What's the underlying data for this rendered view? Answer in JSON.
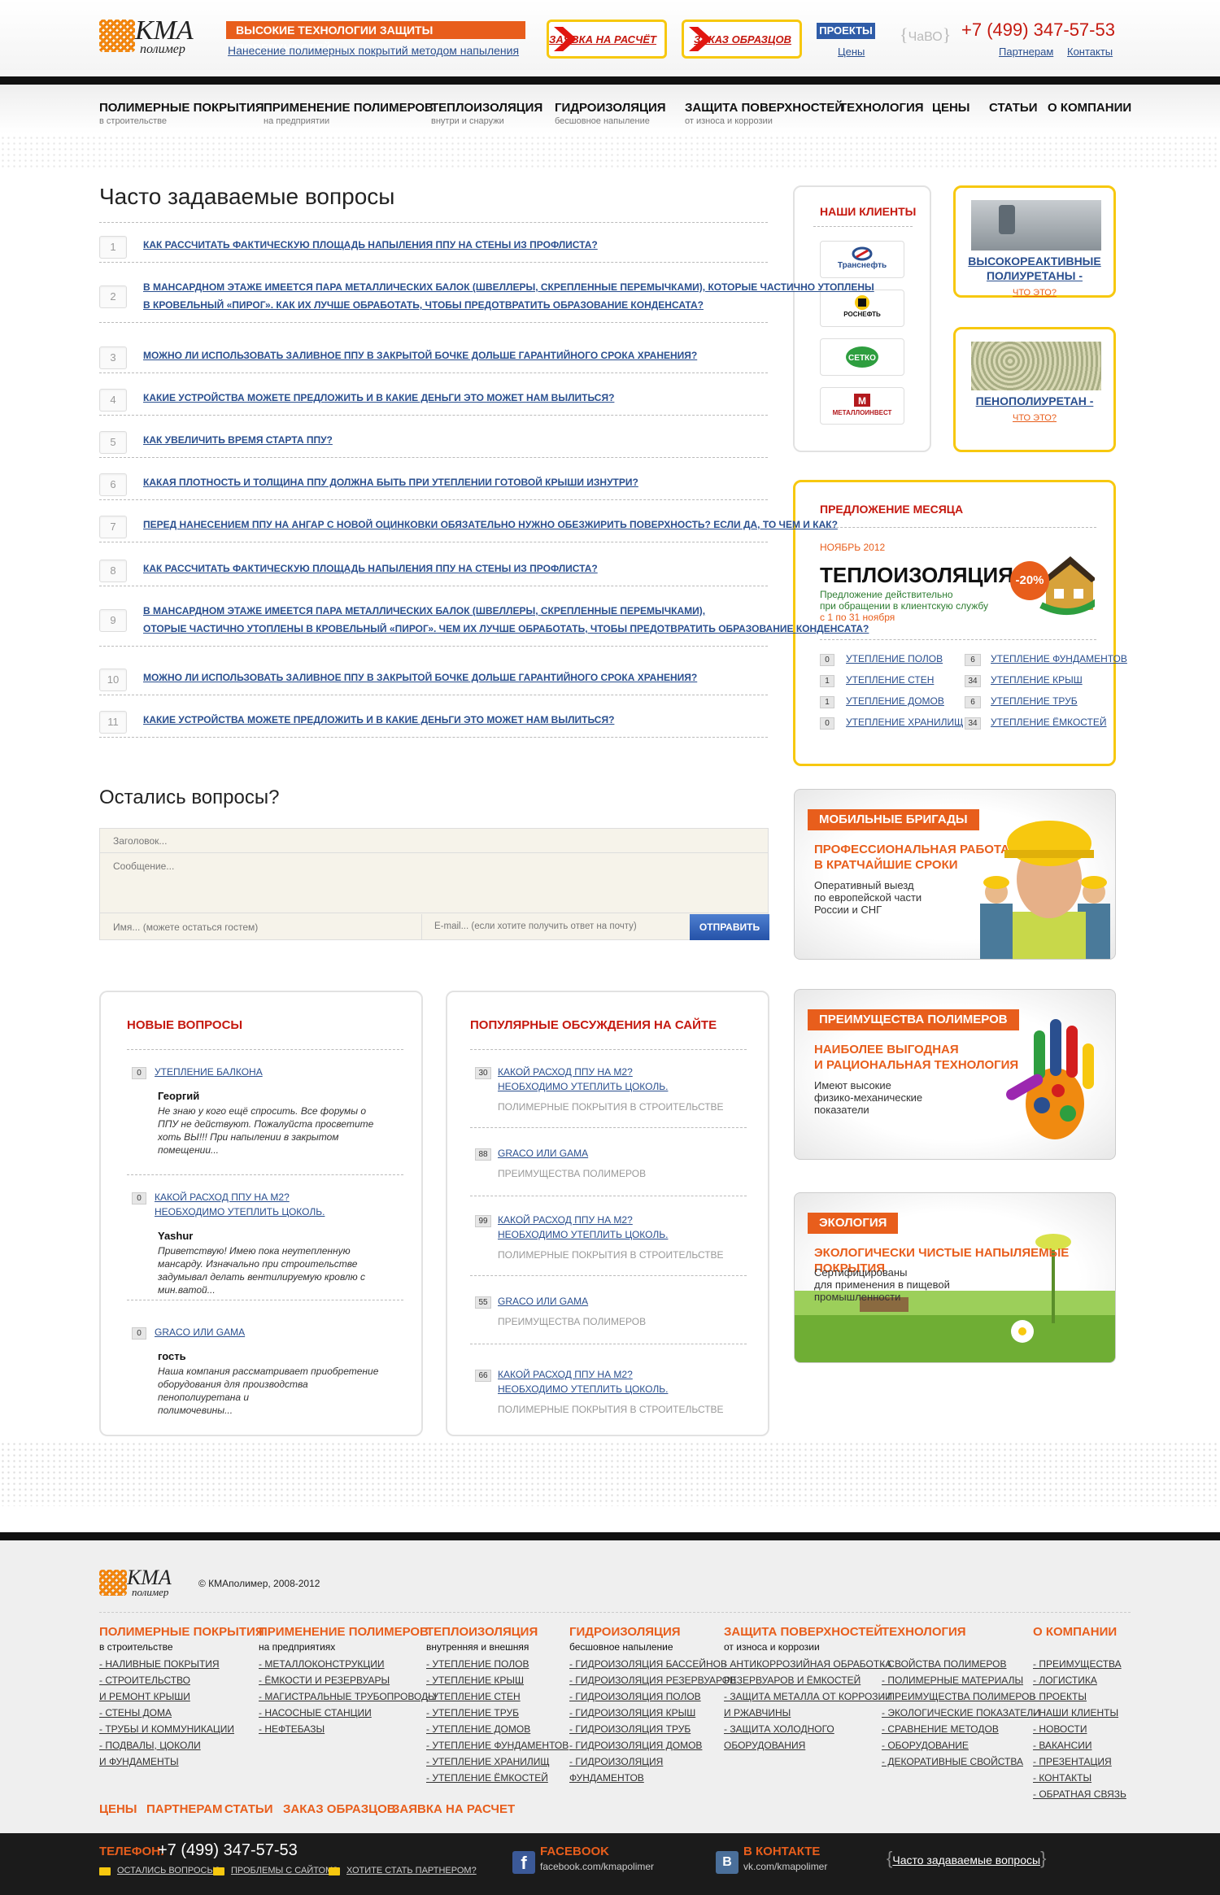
{
  "header": {
    "logo_title": "КМА",
    "logo_sub": "полимер",
    "slogan": "ВЫСОКИЕ ТЕХНОЛОГИИ ЗАЩИТЫ ПОВЕРХНОСТЕЙ",
    "slogan_link": "Нанесение полимерных покрытий методом напыления",
    "btn_request": "ЗАЯВКА НА РАСЧЁТ",
    "btn_samples": "ЗАКАЗ ОБРАЗЦОВ",
    "projects": "ПРОЕКТЫ",
    "prices": "Цены",
    "faq": "ЧаВО",
    "phone": "+7 (499) 347-57-53",
    "partners": "Партнерам",
    "contacts": "Контакты"
  },
  "nav": [
    {
      "title": "ПОЛИМЕРНЫЕ ПОКРЫТИЯ",
      "sub": "в строительстве"
    },
    {
      "title": "ПРИМЕНЕНИЕ ПОЛИМЕРОВ",
      "sub": "на предприятии"
    },
    {
      "title": "ТЕПЛОИЗОЛЯЦИЯ",
      "sub": "внутри и снаружи"
    },
    {
      "title": "ГИДРОИЗОЛЯЦИЯ",
      "sub": "бесшовное напыление"
    },
    {
      "title": "ЗАЩИТА ПОВЕРХНОСТЕЙ",
      "sub": "от износа и коррозии"
    },
    {
      "title": "ТЕХНОЛОГИЯ",
      "sub": ""
    },
    {
      "title": "ЦЕНЫ",
      "sub": ""
    },
    {
      "title": "СТАТЬИ",
      "sub": ""
    },
    {
      "title": "О КОМПАНИИ",
      "sub": ""
    }
  ],
  "faq": {
    "title": "Часто задаваемые вопросы",
    "items": [
      {
        "n": "1",
        "l1": "КАК РАССЧИТАТЬ ФАКТИЧЕСКУЮ ПЛОЩАДЬ НАПЫЛЕНИЯ ППУ НА СТЕНЫ ИЗ ПРОФЛИСТА?",
        "l2": ""
      },
      {
        "n": "2",
        "l1": "В МАНСАРДНОМ ЭТАЖЕ ИМЕЕТСЯ ПАРА МЕТАЛЛИЧЕСКИХ БАЛОК (ШВЕЛЛЕРЫ, СКРЕПЛЕННЫЕ ПЕРЕМЫЧКАМИ), КОТОРЫЕ ЧАСТИЧНО УТОПЛЕНЫ",
        "l2": "В КРОВЕЛЬНЫЙ «ПИРОГ». КАК ИХ ЛУЧШЕ ОБРАБОТАТЬ, ЧТОБЫ ПРЕДОТВРАТИТЬ ОБРАЗОВАНИЕ КОНДЕНСАТА?"
      },
      {
        "n": "3",
        "l1": "МОЖНО ЛИ ИСПОЛЬЗОВАТЬ ЗАЛИВНОЕ ППУ В ЗАКРЫТОЙ БОЧКЕ ДОЛЬШЕ ГАРАНТИЙНОГО СРОКА ХРАНЕНИЯ?",
        "l2": ""
      },
      {
        "n": "4",
        "l1": "КАКИЕ УСТРОЙСТВА МОЖЕТЕ ПРЕДЛОЖИТЬ И В КАКИЕ ДЕНЬГИ ЭТО МОЖЕТ НАМ ВЫЛИТЬСЯ?",
        "l2": ""
      },
      {
        "n": "5",
        "l1": "КАК УВЕЛИЧИТЬ ВРЕМЯ СТАРТА ППУ?",
        "l2": ""
      },
      {
        "n": "6",
        "l1": "КАКАЯ ПЛОТНОСТЬ И ТОЛЩИНА ППУ ДОЛЖНА БЫТЬ ПРИ УТЕПЛЕНИИ ГОТОВОЙ КРЫШИ ИЗНУТРИ?",
        "l2": ""
      },
      {
        "n": "7",
        "l1": "ПЕРЕД НАНЕСЕНИЕМ ППУ НА АНГАР С НОВОЙ ОЦИНКОВКИ ОБЯЗАТЕЛЬНО НУЖНО ОБЕЗЖИРИТЬ ПОВЕРХНОСТЬ? ЕСЛИ ДА, ТО ЧЕМ И КАК?",
        "l2": ""
      },
      {
        "n": "8",
        "l1": "КАК РАССЧИТАТЬ ФАКТИЧЕСКУЮ ПЛОЩАДЬ НАПЫЛЕНИЯ ППУ НА СТЕНЫ ИЗ ПРОФЛИСТА?",
        "l2": ""
      },
      {
        "n": "9",
        "l1": "В МАНСАРДНОМ ЭТАЖЕ ИМЕЕТСЯ ПАРА МЕТАЛЛИЧЕСКИХ БАЛОК (ШВЕЛЛЕРЫ, СКРЕПЛЕННЫЕ ПЕРЕМЫЧКАМИ),",
        "l2": "ОТОРЫЕ ЧАСТИЧНО УТОПЛЕНЫ В КРОВЕЛЬНЫЙ «ПИРОГ». ЧЕМ ИХ ЛУЧШЕ ОБРАБОТАТЬ, ЧТОБЫ ПРЕДОТВРАТИТЬ ОБРАЗОВАНИЕ КОНДЕНСАТА?"
      },
      {
        "n": "10",
        "l1": "МОЖНО ЛИ ИСПОЛЬЗОВАТЬ ЗАЛИВНОЕ ППУ В ЗАКРЫТОЙ БОЧКЕ ДОЛЬШЕ ГАРАНТИЙНОГО СРОКА ХРАНЕНИЯ?",
        "l2": ""
      },
      {
        "n": "11",
        "l1": "КАКИЕ УСТРОЙСТВА МОЖЕТЕ ПРЕДЛОЖИТЬ И В КАКИЕ ДЕНЬГИ ЭТО МОЖЕТ НАМ ВЫЛИТЬСЯ?",
        "l2": ""
      }
    ]
  },
  "ask": {
    "title": "Остались вопросы?",
    "subject_ph": "Заголовок...",
    "message_ph": "Сообщение...",
    "name_ph": "Имя... (можете остаться гостем)",
    "email_ph": "E-mail... (если хотите получить ответ на почту)",
    "send": "ОТПРАВИТЬ"
  },
  "new_questions": {
    "title": "НОВЫЕ ВОПРОСЫ",
    "items": [
      {
        "count": "0",
        "t1": "УТЕПЛЕНИЕ БАЛКОНА",
        "t2": "",
        "author": "Георгий",
        "text": [
          "Не знаю у кого ещё спросить. Все форумы о",
          "ППУ не действуют. Пожалуйста просветите",
          "хоть ВЫ!!! При напылении в закрытом",
          "помещении..."
        ]
      },
      {
        "count": "0",
        "t1": "КАКОЙ РАСХОД ППУ НА М2?",
        "t2": "НЕОБХОДИМО УТЕПЛИТЬ ЦОКОЛЬ.",
        "author": "Yashur",
        "text": [
          "Приветствую! Имею пока неутепленную",
          "мансарду. Изначально при строительстве",
          "задумывал делать вентилируемую кровлю с",
          "мин.ватой..."
        ]
      },
      {
        "count": "0",
        "t1": "GRACO ИЛИ GAMA",
        "t2": "",
        "author": "гость",
        "text": [
          "Наша компания рассматривает приобретение",
          "оборудования для производства",
          "пенополиуретана и",
          "полимочевины..."
        ]
      }
    ]
  },
  "popular": {
    "title": "ПОПУЛЯРНЫЕ ОБСУЖДЕНИЯ НА САЙТЕ",
    "items": [
      {
        "count": "30",
        "t1": "КАКОЙ РАСХОД ППУ НА М2?",
        "t2": "НЕОБХОДИМО УТЕПЛИТЬ ЦОКОЛЬ.",
        "cat": "ПОЛИМЕРНЫЕ ПОКРЫТИЯ В СТРОИТЕЛЬСТВЕ"
      },
      {
        "count": "88",
        "t1": "GRACO ИЛИ GAMA",
        "t2": "",
        "cat": "ПРЕИМУЩЕСТВА ПОЛИМЕРОВ"
      },
      {
        "count": "99",
        "t1": "КАКОЙ РАСХОД ППУ НА М2?",
        "t2": "НЕОБХОДИМО УТЕПЛИТЬ ЦОКОЛЬ.",
        "cat": "ПОЛИМЕРНЫЕ ПОКРЫТИЯ В СТРОИТЕЛЬСТВЕ"
      },
      {
        "count": "55",
        "t1": "GRACO ИЛИ GAMA",
        "t2": "",
        "cat": "ПРЕИМУЩЕСТВА ПОЛИМЕРОВ"
      },
      {
        "count": "66",
        "t1": "КАКОЙ РАСХОД ППУ НА М2?",
        "t2": "НЕОБХОДИМО УТЕПЛИТЬ ЦОКОЛЬ.",
        "cat": "ПОЛИМЕРНЫЕ ПОКРЫТИЯ В СТРОИТЕЛЬСТВЕ"
      }
    ]
  },
  "clients": {
    "title": "НАШИ КЛИЕНТЫ",
    "logos": [
      "Транснефть",
      "РОСНЕФТЬ",
      "СЕТКО",
      "МЕТАЛЛОИНВЕСТ"
    ]
  },
  "products": [
    {
      "title": "ВЫСОКОРЕАКТИВНЫЕ ПОЛИУРЕТАНЫ -",
      "link": "ЧТО ЭТО?"
    },
    {
      "title": "ПЕНОПОЛИУРЕТАН -",
      "link": "ЧТО ЭТО?"
    }
  ],
  "offer": {
    "title": "ПРЕДЛОЖЕНИЕ МЕСЯЦА",
    "date": "НОЯБРЬ 2012",
    "name": "ТЕПЛОИЗОЛЯЦИЯ",
    "discount": "-20%",
    "desc1": "Предложение действительно",
    "desc2": "при обращении в клиентскую службу",
    "desc3": "с 1 по 31 ноября",
    "links_left": [
      {
        "count": "0",
        "label": "УТЕПЛЕНИЕ ПОЛОВ"
      },
      {
        "count": "1",
        "label": "УТЕПЛЕНИЕ СТЕН"
      },
      {
        "count": "1",
        "label": "УТЕПЛЕНИЕ ДОМОВ"
      },
      {
        "count": "0",
        "label": "УТЕПЛЕНИЕ ХРАНИЛИЩ"
      }
    ],
    "links_right": [
      {
        "count": "6",
        "label": "УТЕПЛЕНИЕ ФУНДАМЕНТОВ"
      },
      {
        "count": "34",
        "label": "УТЕПЛЕНИЕ КРЫШ"
      },
      {
        "count": "6",
        "label": "УТЕПЛЕНИЕ ТРУБ"
      },
      {
        "count": "34",
        "label": "УТЕПЛЕНИЕ ЁМКОСТЕЙ"
      }
    ]
  },
  "promos": [
    {
      "tag": "МОБИЛЬНЫЕ БРИГАДЫ",
      "o1": "ПРОФЕССИОНАЛЬНАЯ РАБОТА",
      "o2": "В КРАТЧАЙШИЕ СРОКИ",
      "d1": "Оперативный выезд",
      "d2": "по европейской части",
      "d3": "России и СНГ"
    },
    {
      "tag": "ПРЕИМУЩЕСТВА ПОЛИМЕРОВ",
      "o1": "НАИБОЛЕЕ ВЫГОДНАЯ",
      "o2": "И РАЦИОНАЛЬНАЯ ТЕХНОЛОГИЯ",
      "d1": "Имеют высокие",
      "d2": "физико-механические",
      "d3": "показатели"
    },
    {
      "tag": "ЭКОЛОГИЯ",
      "o1": "ЭКОЛОГИЧЕСКИ ЧИСТЫЕ НАПЫЛЯЕМЫЕ ПОКРЫТИЯ",
      "o2": "",
      "d1": "Сертифицированы",
      "d2": "для применения в пищевой",
      "d3": "промышленности"
    }
  ],
  "footer": {
    "copyright": "© КМАполимер, 2008-2012",
    "cols": [
      {
        "h": "ПОЛИМЕРНЫЕ ПОКРЫТИЯ",
        "s": "в строительстве",
        "links": [
          "- НАЛИВНЫЕ ПОКРЫТИЯ",
          "- СТРОИТЕЛЬСТВО",
          "И РЕМОНТ КРЫШИ",
          "- СТЕНЫ ДОМА",
          "- ТРУБЫ И КОММУНИКАЦИИ",
          "- ПОДВАЛЫ, ЦОКОЛИ",
          "И ФУНДАМЕНТЫ"
        ]
      },
      {
        "h": "ПРИМЕНЕНИЕ ПОЛИМЕРОВ",
        "s": "на предприятиях",
        "links": [
          "- МЕТАЛЛОКОНСТРУКЦИИ",
          "- ЁМКОСТИ И РЕЗЕРВУАРЫ",
          "- МАГИСТРАЛЬНЫЕ ТРУБОПРОВОДЫ",
          "- НАСОСНЫЕ СТАНЦИИ",
          "- НЕФТЕБАЗЫ"
        ]
      },
      {
        "h": "ТЕПЛОИЗОЛЯЦИЯ",
        "s": "внутренняя и внешняя",
        "links": [
          "- УТЕПЛЕНИЕ ПОЛОВ",
          "- УТЕПЛЕНИЕ КРЫШ",
          "- УТЕПЛЕНИЕ СТЕН",
          "- УТЕПЛЕНИЕ ТРУБ",
          "- УТЕПЛЕНИЕ ДОМОВ",
          "- УТЕПЛЕНИЕ ФУНДАМЕНТОВ",
          "- УТЕПЛЕНИЕ ХРАНИЛИЩ",
          "- УТЕПЛЕНИЕ ЁМКОСТЕЙ"
        ]
      },
      {
        "h": "ГИДРОИЗОЛЯЦИЯ",
        "s": "бесшовное напыление",
        "links": [
          "- ГИДРОИЗОЛЯЦИЯ БАССЕЙНОВ",
          "- ГИДРОИЗОЛЯЦИЯ РЕЗЕРВУАРОВ",
          "- ГИДРОИЗОЛЯЦИЯ ПОЛОВ",
          "- ГИДРОИЗОЛЯЦИЯ КРЫШ",
          "- ГИДРОИЗОЛЯЦИЯ ТРУБ",
          "- ГИДРОИЗОЛЯЦИЯ ДОМОВ",
          "- ГИДРОИЗОЛЯЦИЯ",
          "ФУНДАМЕНТОВ"
        ]
      },
      {
        "h": "ЗАЩИТА ПОВЕРХНОСТЕЙ",
        "s": "от износа и коррозии",
        "links": [
          "- АНТИКОРРОЗИЙНАЯ ОБРАБОТКА",
          "РЕЗЕРВУАРОВ И ЁМКОСТЕЙ",
          "- ЗАЩИТА МЕТАЛЛА ОТ КОРРОЗИИ",
          "И РЖАВЧИНЫ",
          "- ЗАЩИТА ХОЛОДНОГО",
          "ОБОРУДОВАНИЯ"
        ]
      },
      {
        "h": "ТЕХНОЛОГИЯ",
        "s": "",
        "links": [
          "- СВОЙСТВА ПОЛИМЕРОВ",
          "- ПОЛИМЕРНЫЕ МАТЕРИАЛЫ",
          "- ПРЕИМУЩЕСТВА ПОЛИМЕРОВ",
          "- ЭКОЛОГИЧЕСКИЕ ПОКАЗАТЕЛИ",
          "- СРАВНЕНИЕ МЕТОДОВ",
          "- ОБОРУДОВАНИЕ",
          "- ДЕКОРАТИВНЫЕ СВОЙСТВА"
        ]
      },
      {
        "h": "О КОМПАНИИ",
        "s": "",
        "links": [
          "- ПРЕИМУЩЕСТВА",
          "- ЛОГИСТИКА",
          "- ПРОЕКТЫ",
          "- НАШИ КЛИЕНТЫ",
          "- НОВОСТИ",
          "- ВАКАНСИИ",
          "- ПРЕЗЕНТАЦИЯ",
          "- КОНТАКТЫ",
          "- ОБРАТНАЯ СВЯЗЬ"
        ]
      }
    ],
    "bottom_links": [
      "ЦЕНЫ",
      "ПАРТНЕРАМ",
      "СТАТЬИ",
      "ЗАКАЗ ОБРАЗЦОВ",
      "ЗАЯВКА НА РАСЧЕТ"
    ],
    "phone_label": "ТЕЛЕФОН:",
    "phone": "+7 (499) 347-57-53",
    "mail_links": [
      "ОСТАЛИСЬ ВОПРОСЫ?",
      "ПРОБЛЕМЫ С САЙТОМ?",
      "ХОТИТЕ СТАТЬ ПАРТНЕРОМ?"
    ],
    "fb_title": "FACEBOOK",
    "fb_url": "facebook.com/kmapolimer",
    "vk_title": "В КОНТАКТЕ",
    "vk_url": "vk.com/kmapolimer",
    "faq_link": "Часто задаваемые вопросы"
  },
  "colors": {
    "accent": "#e85e1c",
    "link": "#2a4f8f",
    "yellow": "#f7c80f",
    "red": "#c5190f"
  }
}
